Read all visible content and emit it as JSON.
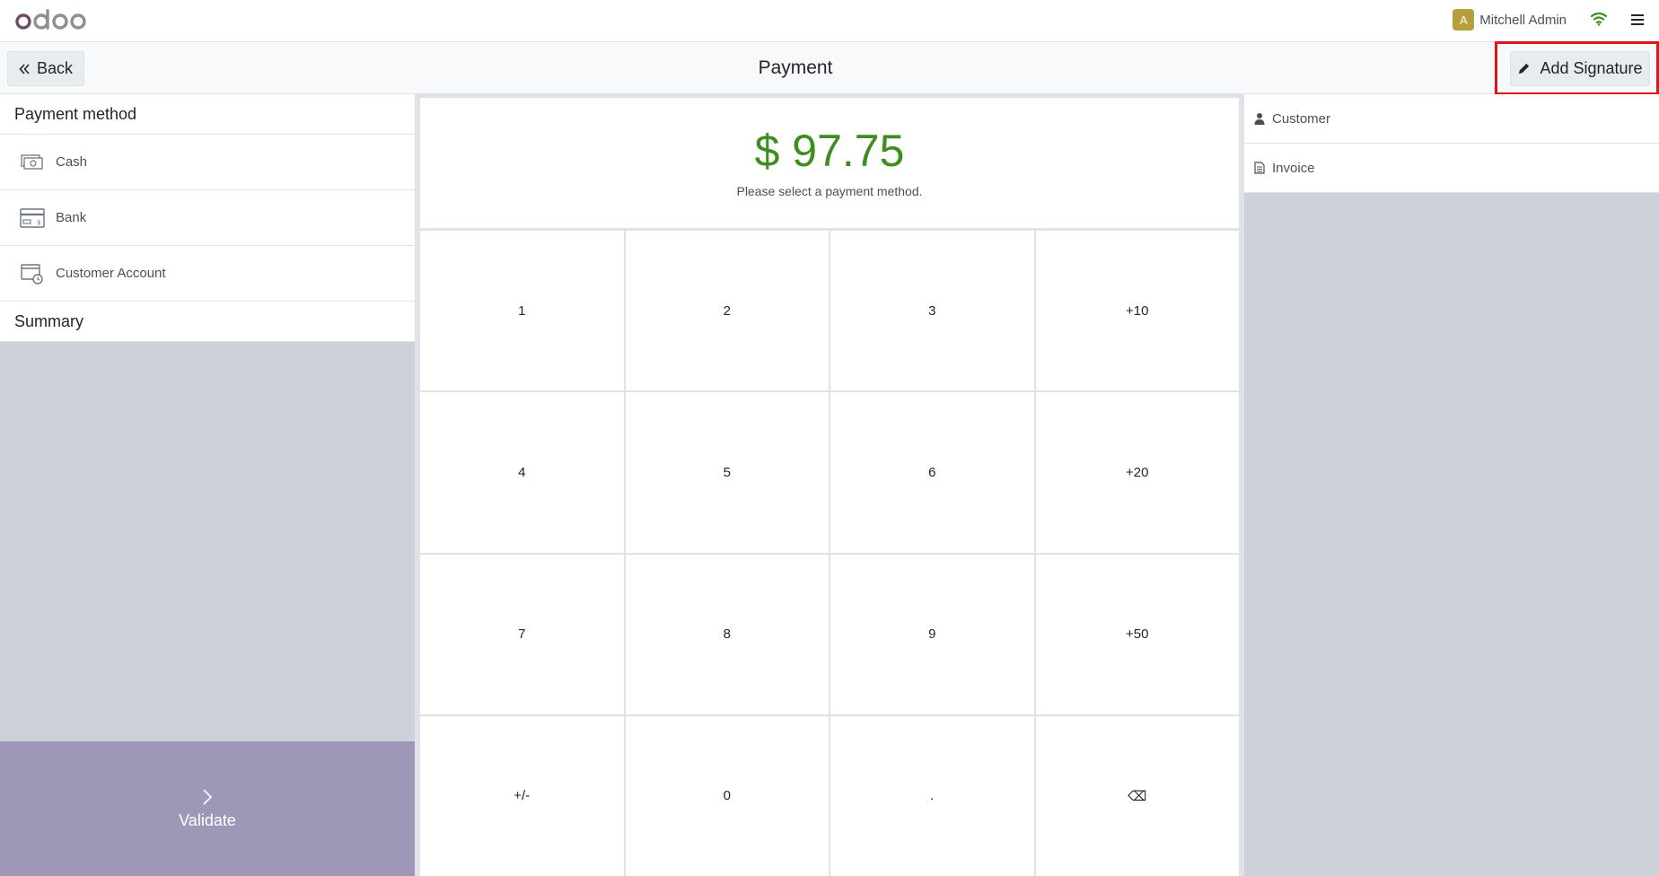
{
  "topbar": {
    "logo_alt": "odoo",
    "user": {
      "initial": "A",
      "name": "Mitchell Admin"
    }
  },
  "controlbar": {
    "back_label": "Back",
    "title": "Payment",
    "add_signature_label": "Add Signature"
  },
  "left": {
    "payment_method_header": "Payment method",
    "methods": [
      {
        "label": "Cash"
      },
      {
        "label": "Bank"
      },
      {
        "label": "Customer Account"
      }
    ],
    "summary_header": "Summary",
    "validate_label": "Validate"
  },
  "center": {
    "amount": "$ 97.75",
    "hint": "Please select a payment method.",
    "keys": [
      "1",
      "2",
      "3",
      "+10",
      "4",
      "5",
      "6",
      "+20",
      "7",
      "8",
      "9",
      "+50",
      "+/-",
      "0",
      ".",
      "⌫"
    ]
  },
  "right": {
    "customer_label": "Customer",
    "invoice_label": "Invoice"
  },
  "colors": {
    "amount": "#3e8e1f",
    "validate_bg": "#9e97b8",
    "highlight": "#e0141b",
    "odoo_purple": "#714b67"
  }
}
